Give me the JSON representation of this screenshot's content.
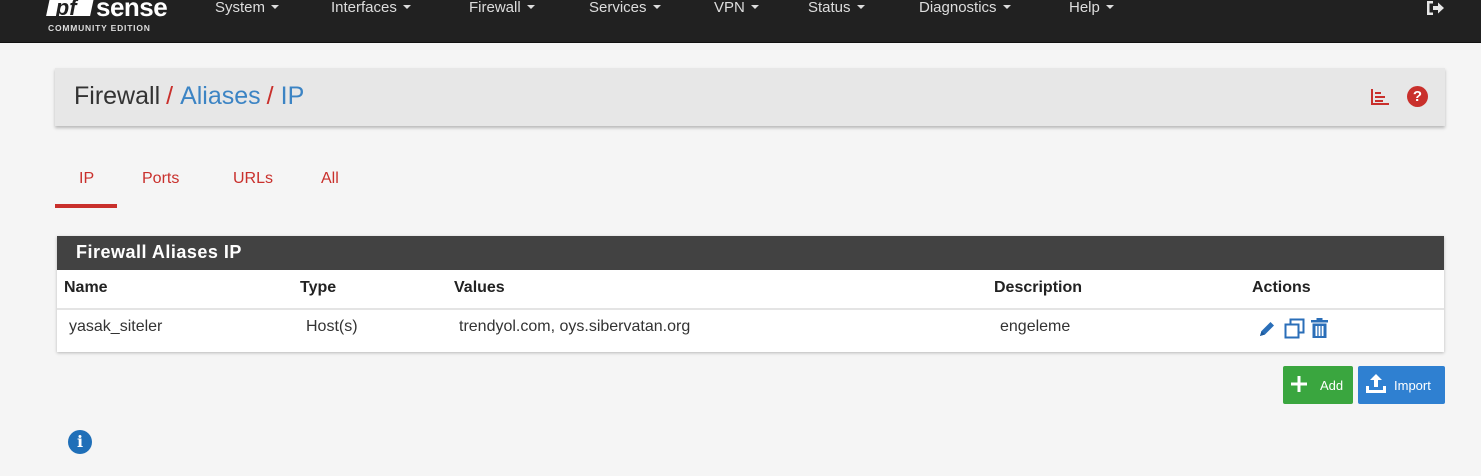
{
  "brand": {
    "logo_box": "pf",
    "logo_word": "sense",
    "edition": "COMMUNITY EDITION"
  },
  "nav": {
    "items": [
      {
        "label": "System"
      },
      {
        "label": "Interfaces"
      },
      {
        "label": "Firewall"
      },
      {
        "label": "Services"
      },
      {
        "label": "VPN"
      },
      {
        "label": "Status"
      },
      {
        "label": "Diagnostics"
      },
      {
        "label": "Help"
      }
    ],
    "logout_icon": "sign-out-icon"
  },
  "breadcrumb": {
    "root": "Firewall",
    "middle": "Aliases",
    "current": "IP",
    "separator": "/",
    "help_glyph": "?"
  },
  "tabs": [
    {
      "label": "IP",
      "active": true
    },
    {
      "label": "Ports"
    },
    {
      "label": "URLs"
    },
    {
      "label": "All"
    }
  ],
  "panel": {
    "title": "Firewall Aliases IP",
    "columns": [
      "Name",
      "Type",
      "Values",
      "Description",
      "Actions"
    ],
    "rows": [
      {
        "name": "yasak_siteler",
        "type": "Host(s)",
        "values": "trendyol.com, oys.sibervatan.org",
        "description": "engeleme",
        "actions": [
          "edit-icon",
          "copy-icon",
          "delete-icon"
        ]
      }
    ]
  },
  "buttons": {
    "add": "Add",
    "import": "Import"
  },
  "colors": {
    "accent_red": "#c9302c",
    "link_blue": "#3c84c4",
    "add_green": "#3aa63f",
    "import_blue": "#2f80d1",
    "nav_bg": "#212121",
    "panel_head": "#424242"
  }
}
